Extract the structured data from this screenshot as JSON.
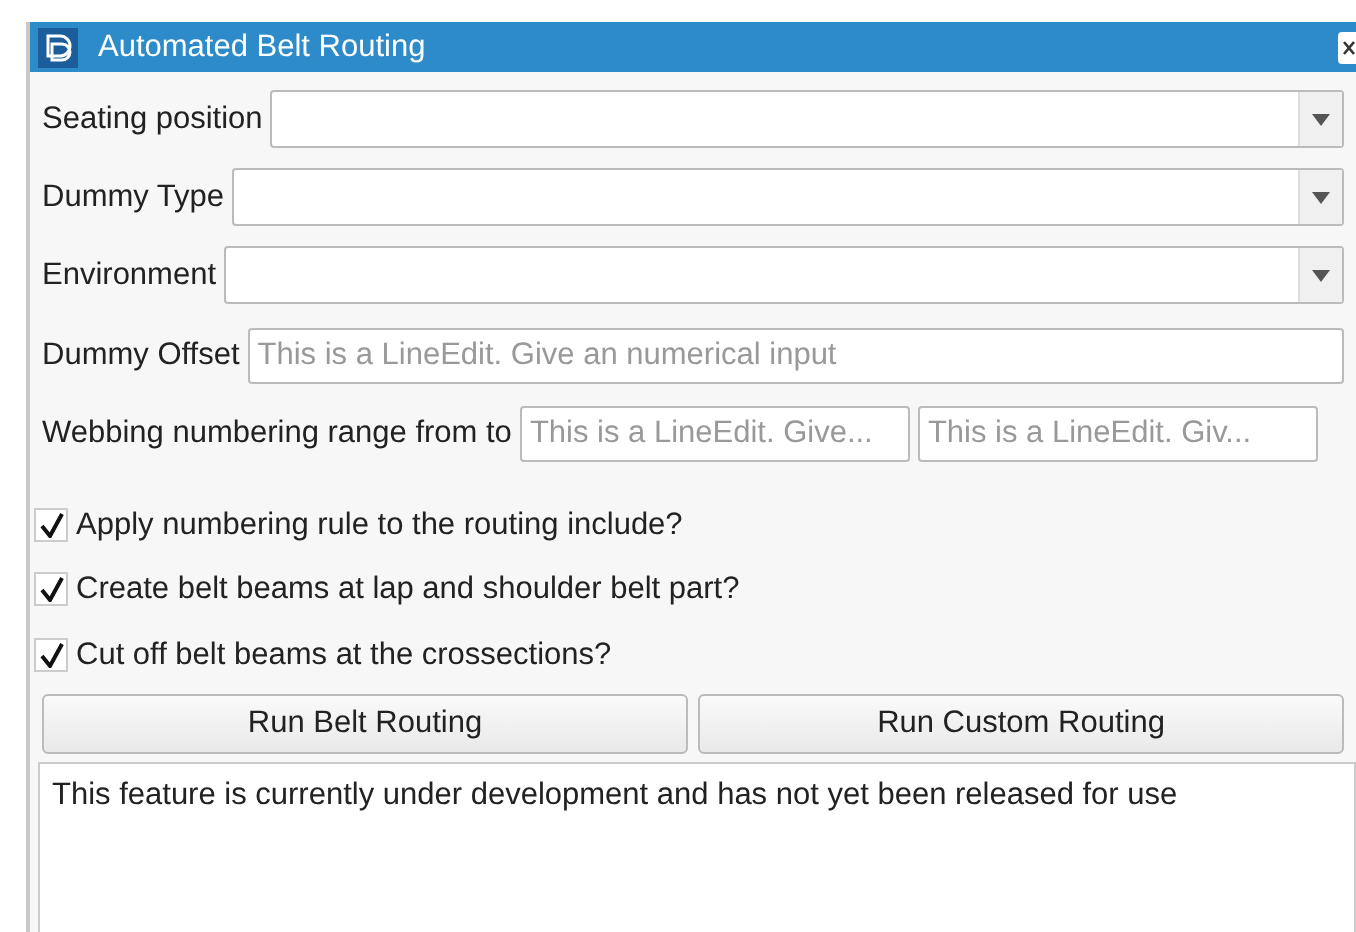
{
  "window": {
    "title": "Automated Belt Routing"
  },
  "dropdowns": [
    {
      "label": "Seating position"
    },
    {
      "label": "Dummy Type"
    },
    {
      "label": "Environment"
    }
  ],
  "dummy_offset": {
    "label": "Dummy Offset",
    "placeholder": "This is a LineEdit. Give an numerical input"
  },
  "webbing_range": {
    "label": "Webbing numbering range from to",
    "from_placeholder": "This is a LineEdit. Give...",
    "to_placeholder": "This is a LineEdit. Giv..."
  },
  "checkboxes": [
    {
      "label": "Apply numbering rule to the routing include?",
      "checked": true
    },
    {
      "label": "Create belt beams at lap and shoulder belt part?",
      "checked": true
    },
    {
      "label": "Cut off belt beams at the crossections?",
      "checked": true
    }
  ],
  "buttons": [
    "Run Belt Routing",
    "Run Custom Routing"
  ],
  "output": {
    "text": "This feature is currently under development and has not yet been released for use"
  }
}
